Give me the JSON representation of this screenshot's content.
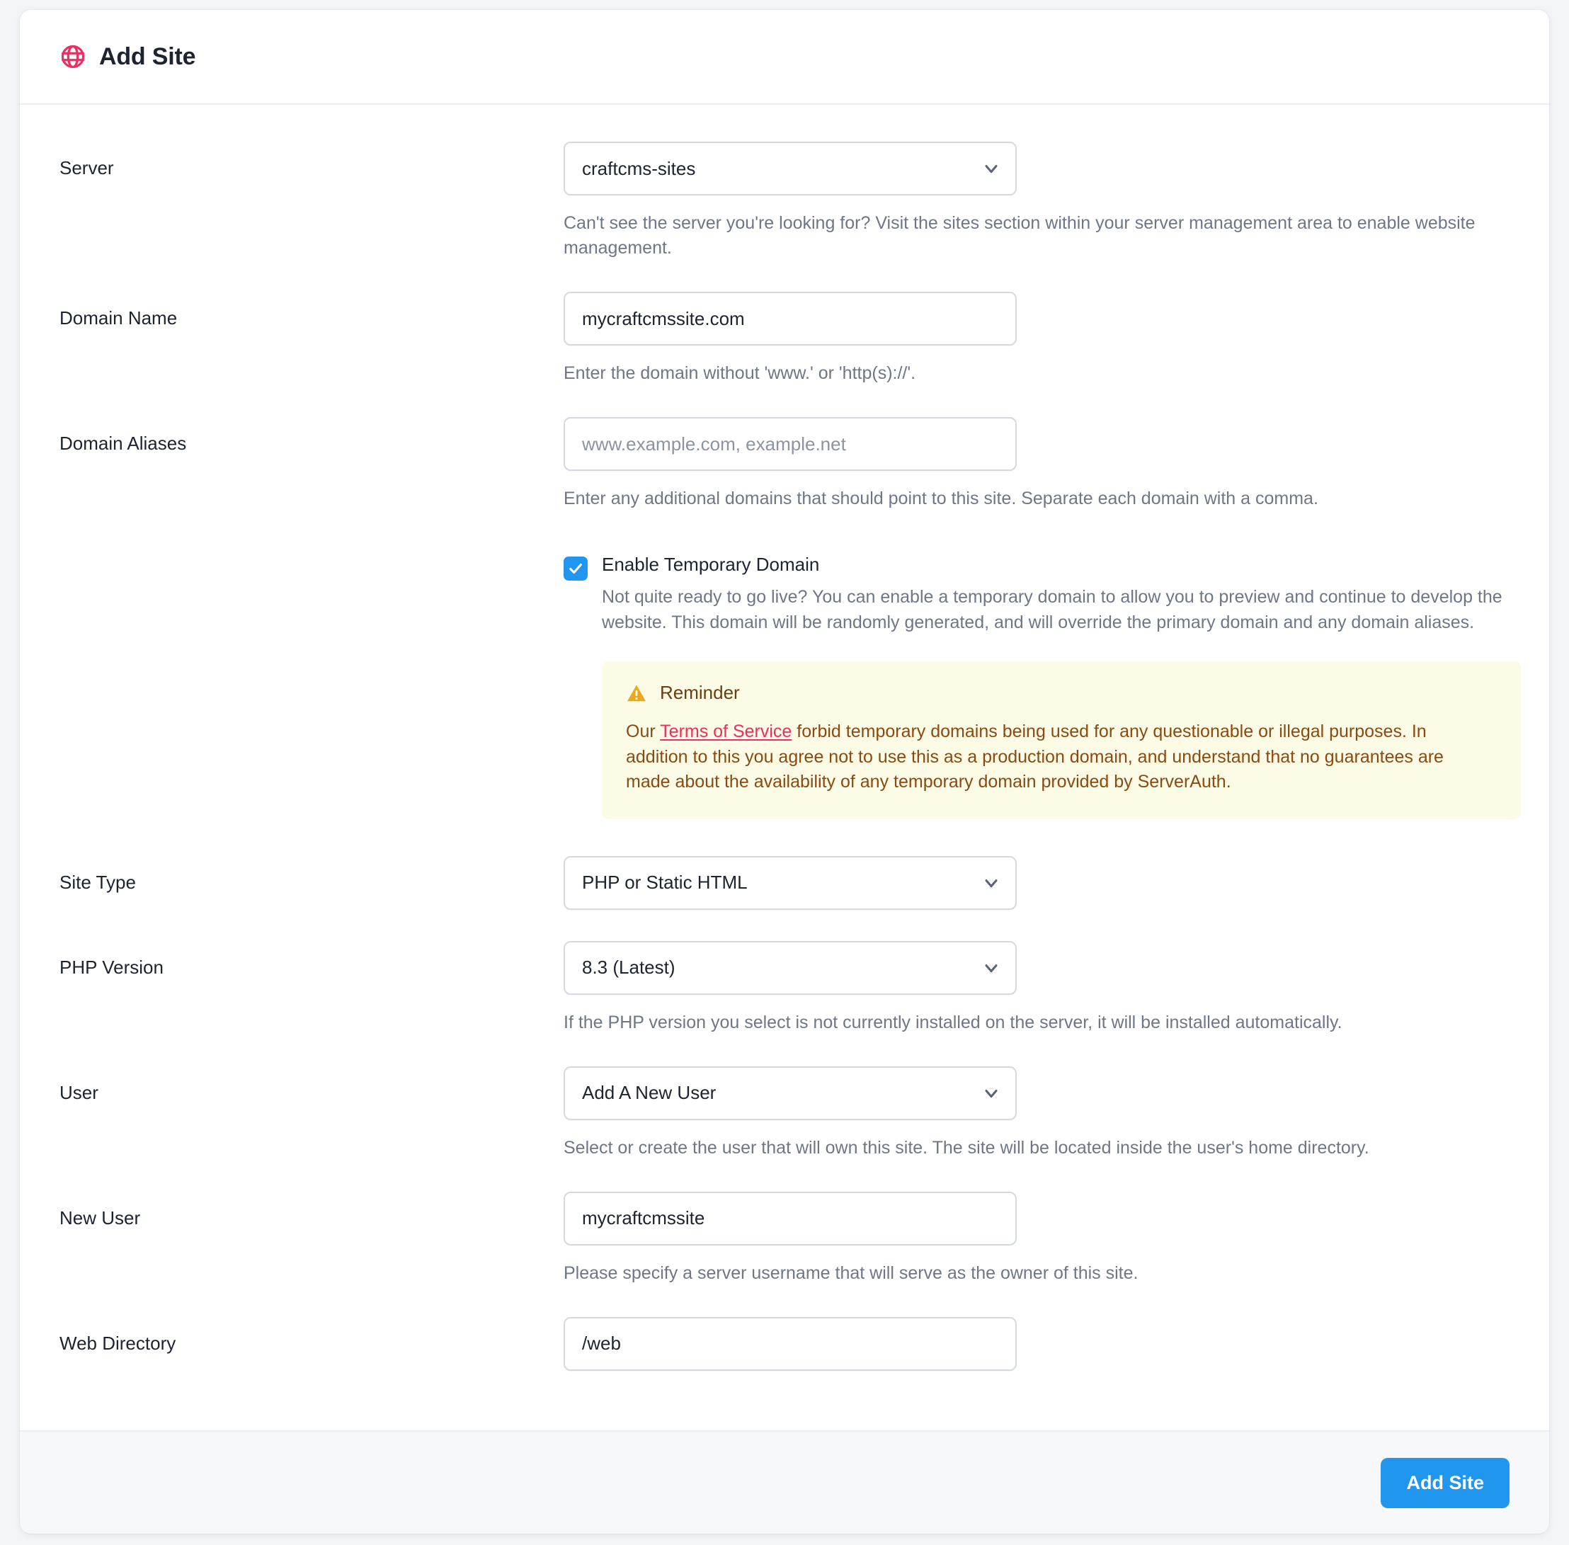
{
  "header": {
    "icon": "globe-icon",
    "title": "Add Site",
    "icon_color": "#ed2e63"
  },
  "form": {
    "server": {
      "label": "Server",
      "value": "craftcms-sites",
      "help": "Can't see the server you're looking for? Visit the sites section within your server management area to enable website management."
    },
    "domain_name": {
      "label": "Domain Name",
      "value": "mycraftcmssite.com",
      "help": "Enter the domain without 'www.' or 'http(s)://'."
    },
    "domain_aliases": {
      "label": "Domain Aliases",
      "value": "",
      "placeholder": "www.example.com, example.net",
      "help": "Enter any additional domains that should point to this site. Separate each domain with a comma."
    },
    "temporary_domain": {
      "checked": true,
      "label": "Enable Temporary Domain",
      "description": "Not quite ready to go live? You can enable a temporary domain to allow you to preview and continue to develop the website. This domain will be randomly generated, and will override the primary domain and any domain aliases."
    },
    "reminder": {
      "icon": "warning-triangle-icon",
      "title": "Reminder",
      "text_before_link": "Our ",
      "link_text": "Terms of Service",
      "text_after_link": " forbid temporary domains being used for any questionable or illegal purposes. In addition to this you agree not to use this as a production domain, and understand that no guarantees are made about the availability of any temporary domain provided by ServerAuth.",
      "bg_color": "#fcfbe5",
      "text_color": "#8a4a12",
      "link_color": "#ed2e63"
    },
    "site_type": {
      "label": "Site Type",
      "value": "PHP or Static HTML"
    },
    "php_version": {
      "label": "PHP Version",
      "value": "8.3 (Latest)",
      "help": "If the PHP version you select is not currently installed on the server, it will be installed automatically."
    },
    "user": {
      "label": "User",
      "value": "Add A New User",
      "help": "Select or create the user that will own this site. The site will be located inside the user's home directory."
    },
    "new_user": {
      "label": "New User",
      "value": "mycraftcmssite",
      "help": "Please specify a server username that will serve as the owner of this site."
    },
    "web_directory": {
      "label": "Web Directory",
      "value": "/web"
    }
  },
  "footer": {
    "submit_label": "Add Site",
    "accent_color": "#2196ef"
  }
}
